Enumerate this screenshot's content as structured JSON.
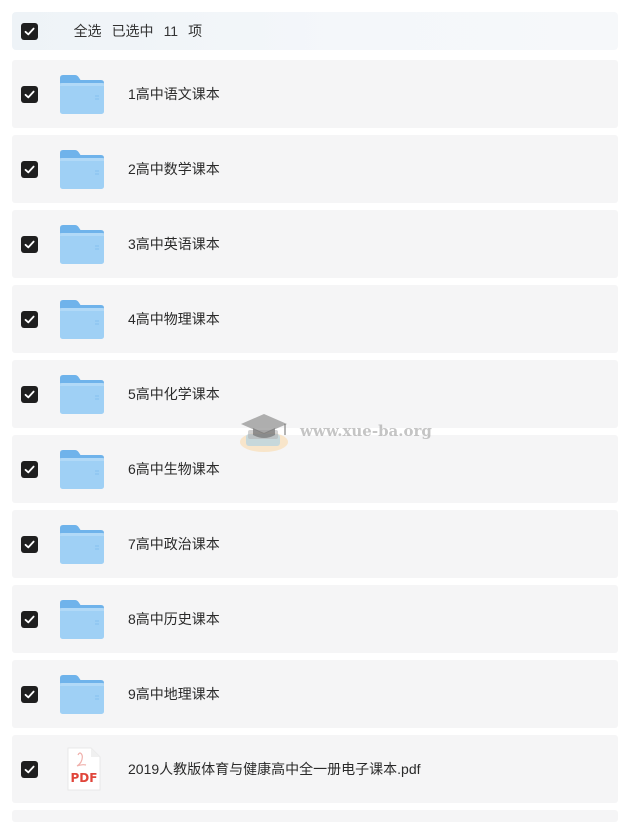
{
  "header": {
    "select_all_label": "全选",
    "selected_prefix": "已选中",
    "selected_count": "11",
    "selected_suffix": "项",
    "checked": true
  },
  "items": [
    {
      "name": "1高中语文课本",
      "type": "folder",
      "checked": true
    },
    {
      "name": "2高中数学课本",
      "type": "folder",
      "checked": true
    },
    {
      "name": "3高中英语课本",
      "type": "folder",
      "checked": true
    },
    {
      "name": "4高中物理课本",
      "type": "folder",
      "checked": true
    },
    {
      "name": "5高中化学课本",
      "type": "folder",
      "checked": true
    },
    {
      "name": "6高中生物课本",
      "type": "folder",
      "checked": true
    },
    {
      "name": "7高中政治课本",
      "type": "folder",
      "checked": true
    },
    {
      "name": "8高中历史课本",
      "type": "folder",
      "checked": true
    },
    {
      "name": "9高中地理课本",
      "type": "folder",
      "checked": true
    },
    {
      "name": "2019人教版体育与健康高中全一册电子课本.pdf",
      "type": "pdf",
      "checked": true
    }
  ],
  "pdf_icon_text": "PDF",
  "watermark": {
    "text": "www.xue-ba.org"
  },
  "colors": {
    "checkbox": "#1f1f1f",
    "folder_light": "#9fd0f5",
    "folder_dark": "#6fb3eb",
    "pdf_red": "#e0453a",
    "row_bg": "#f5f5f6"
  }
}
